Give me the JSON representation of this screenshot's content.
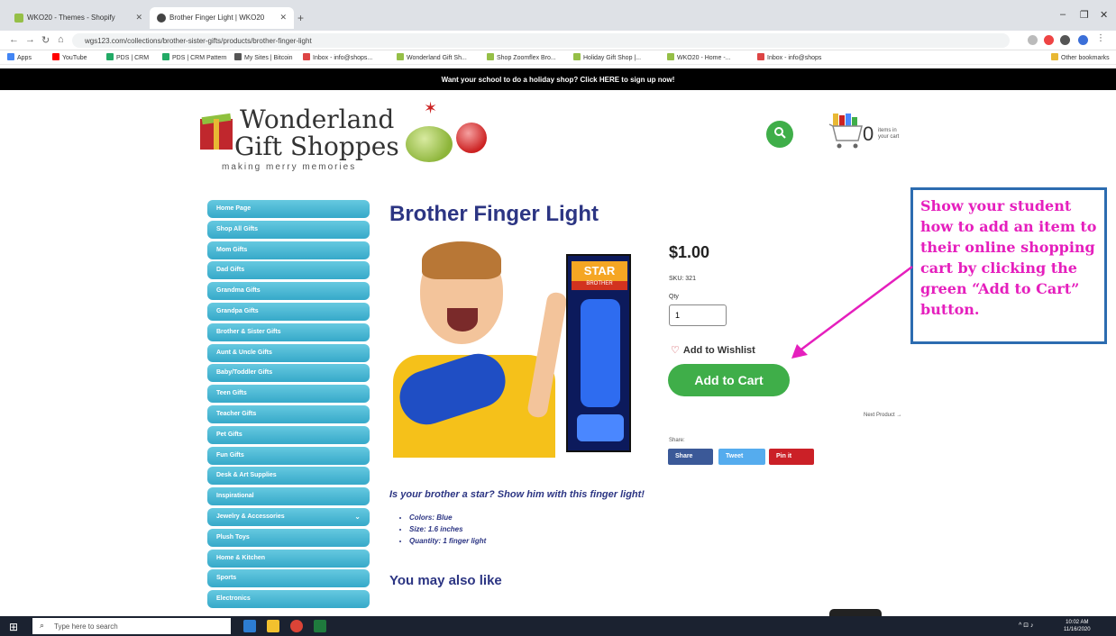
{
  "browser": {
    "tabs": [
      {
        "label": "WKO20 - Themes - Shopify"
      },
      {
        "label": "Brother Finger Light | WKO20"
      }
    ],
    "url": "wgs123.com/collections/brother-sister-gifts/products/brother-finger-light",
    "bookmarks": [
      {
        "label": "Apps",
        "color": "#4285f4"
      },
      {
        "label": "YouTube",
        "color": "#ff0000"
      },
      {
        "label": "PDS | CRM",
        "color": "#2a6"
      },
      {
        "label": "PDS | CRM Pattern",
        "color": "#2a6"
      },
      {
        "label": "My Sites | Bitcoin",
        "color": "#555"
      },
      {
        "label": "Inbox - info@shops...",
        "color": "#d44"
      },
      {
        "label": "Wonderland Gift Sh...",
        "color": "#95bf47"
      },
      {
        "label": "Shop Zoomflex Bro...",
        "color": "#95bf47"
      },
      {
        "label": "Holiday Gift Shop |...",
        "color": "#95bf47"
      },
      {
        "label": "WKO20 - Home -...",
        "color": "#95bf47"
      },
      {
        "label": "Inbox - info@shops",
        "color": "#d44"
      },
      {
        "label": "Other bookmarks",
        "color": "#e8b834"
      }
    ]
  },
  "announcement": "Want your school to do a holiday shop? Click HERE to sign up now!",
  "logo": {
    "line1": "Wonderland",
    "line2": "Gift Shoppes",
    "tagline": "making merry memories"
  },
  "header": {
    "cart_count": "0",
    "cart_label": "items in your cart"
  },
  "sidebar": {
    "items": [
      {
        "label": "Home Page"
      },
      {
        "label": "Shop All Gifts"
      },
      {
        "label": "Mom Gifts"
      },
      {
        "label": "Dad Gifts"
      },
      {
        "label": "Grandma Gifts"
      },
      {
        "label": "Grandpa Gifts"
      },
      {
        "label": "Brother & Sister Gifts"
      },
      {
        "label": "Aunt & Uncle Gifts"
      },
      {
        "label": "Baby/Toddler Gifts"
      },
      {
        "label": "Teen Gifts"
      },
      {
        "label": "Teacher Gifts"
      },
      {
        "label": "Pet Gifts"
      },
      {
        "label": "Fun Gifts"
      },
      {
        "label": "Desk & Art Supplies"
      },
      {
        "label": "Inspirational"
      },
      {
        "label": "Jewelry & Accessories",
        "caret": "⌄"
      },
      {
        "label": "Plush Toys"
      },
      {
        "label": "Home & Kitchen"
      },
      {
        "label": "Sports"
      },
      {
        "label": "Electronics"
      }
    ]
  },
  "product": {
    "title": "Brother Finger Light",
    "price": "$1.00",
    "sku": "SKU: 321",
    "qty_label": "Qty",
    "qty_value": "1",
    "wishlist": "Add to Wishlist",
    "add_to_cart": "Add to Cart",
    "next_product": "Next Product →",
    "share_label": "Share:",
    "share_facebook": "Share",
    "share_twitter": "Tweet",
    "share_pinterest": "Pin it",
    "package_title": "STAR",
    "package_sub": "BROTHER",
    "tagline": "Is your brother a star?  Show him with this finger light!",
    "details": [
      {
        "text": "Colors: Blue"
      },
      {
        "text": "Size: 1.6 inches"
      },
      {
        "text": "Quantity: 1 finger light"
      }
    ],
    "also_like": "You may also like"
  },
  "callout": {
    "text": "Show your student how to add an item to their online shopping cart by clicking the green “Add to Cart” button.",
    "color": "#e51fbd",
    "border_color": "#2c6cb0"
  },
  "taskbar": {
    "search_placeholder": "Type here to search",
    "time": "10:02 AM",
    "date": "11/16/2020"
  },
  "colors": {
    "brand_green": "#3fae49",
    "heading_navy": "#2c3583",
    "sidebar_blue": "#36a9c9"
  }
}
